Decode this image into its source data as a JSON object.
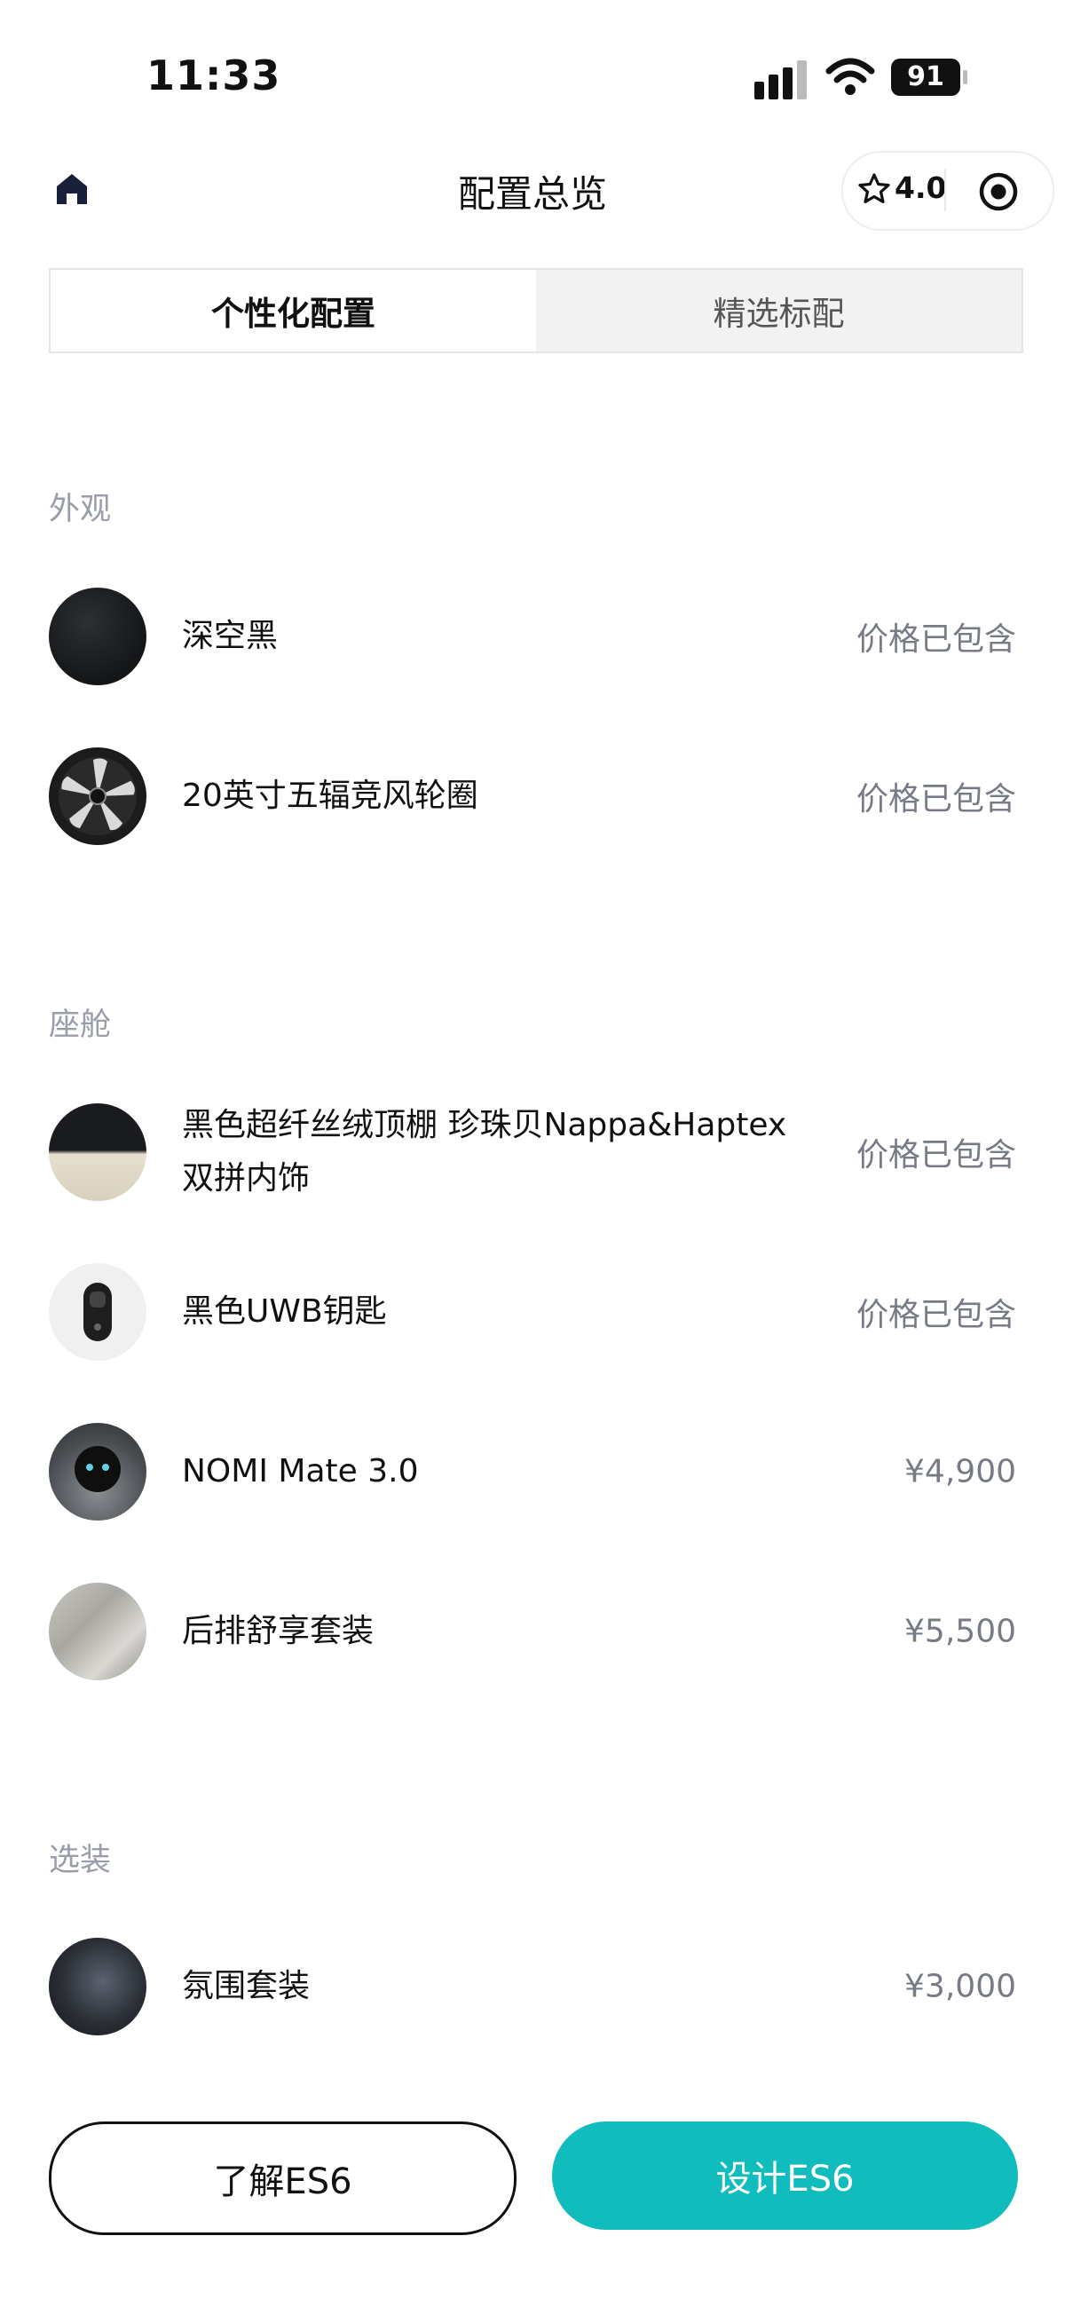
{
  "status_bar": {
    "time": "11:33",
    "battery": "91"
  },
  "nav": {
    "title": "配置总览",
    "rating": "4.0"
  },
  "tabs": [
    {
      "label": "个性化配置",
      "active": true
    },
    {
      "label": "精选标配",
      "active": false
    }
  ],
  "sections": {
    "exterior": {
      "title": "外观",
      "items": [
        {
          "label": "深空黑",
          "price": "价格已包含"
        },
        {
          "label": "20英寸五辐竞风轮圈",
          "price": "价格已包含"
        }
      ]
    },
    "cabin": {
      "title": "座舱",
      "items": [
        {
          "label_line1": "黑色超纤丝绒顶棚 珍珠贝Nappa&Haptex",
          "label_line2": "双拼内饰",
          "price": "价格已包含"
        },
        {
          "label": "黑色UWB钥匙",
          "price": "价格已包含"
        },
        {
          "label": "NOMI Mate 3.0",
          "price": "¥4,900"
        },
        {
          "label": "后排舒享套装",
          "price": "¥5,500"
        }
      ]
    },
    "options": {
      "title": "选装",
      "items": [
        {
          "label": "氛围套装",
          "price": "¥3,000"
        }
      ]
    }
  },
  "buttons": {
    "learn": "了解ES6",
    "design": "设计ES6"
  },
  "colors": {
    "accent": "#10bcbc",
    "muted_text": "#9a9eaa",
    "price_text": "#777b85"
  }
}
